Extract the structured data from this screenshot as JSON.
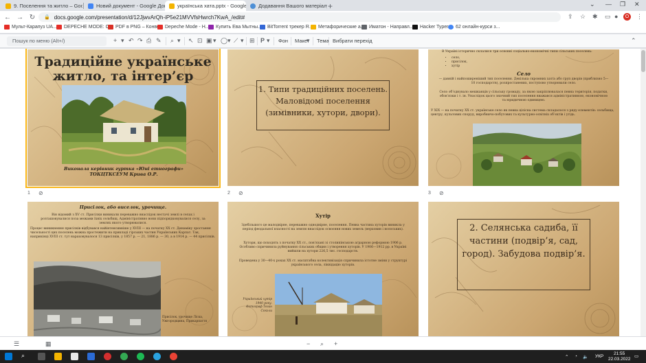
{
  "tabs": [
    {
      "label": "9. Поселення та житло – Google",
      "color": "#f4b400",
      "active": false
    },
    {
      "label": "Новий документ - Google Доку",
      "color": "#4285f4",
      "active": false
    },
    {
      "label": "українська хата.pptx - Google",
      "color": "#f4b400",
      "active": true
    },
    {
      "label": "Додавання Вашого матеріалу н",
      "color": "#4d8fd6",
      "active": false
    }
  ],
  "address": {
    "url": "docs.google.com/presentation/d/12JjwvArQh-iP5e21MVVfsHwrch7KwA_/edit#"
  },
  "bookmarks": [
    {
      "label": "Мульт-Карапуз UA...",
      "color": "#e52d27"
    },
    {
      "label": "DEPECHE MODE: C...",
      "color": "#e52d27"
    },
    {
      "label": "PDF в PNG – Конве...",
      "color": "#d93025"
    },
    {
      "label": "Depeche Mode - H...",
      "color": "#e52d27"
    },
    {
      "label": "Купить Ева Мытны...",
      "color": "#8e24aa"
    },
    {
      "label": "BitTorrent трекер R...",
      "color": "#3367d6"
    },
    {
      "label": "Метафорические а...",
      "color": "#f4b400"
    },
    {
      "label": "Иматон - Направл...",
      "color": "#5f6368"
    },
    {
      "label": "Hacker Typer",
      "color": "#111111"
    },
    {
      "label": "62 онлайн-курси з...",
      "color": "#4285f4"
    }
  ],
  "toolbar": {
    "menu_search_placeholder": "Пошук по меню (Alt+/)",
    "background": "Фон",
    "layout": "Макет",
    "theme": "Тема",
    "transition": "Вибрати перехід"
  },
  "slides": [
    {
      "num": "1",
      "title": "Традиційне українське житло, та інтер’єр",
      "caption": "Виконала керівник гуртка «Юні етнографи» ТОКЦТКСЕУМ Крива О.Р."
    },
    {
      "num": "2",
      "title": "1. Типи традиційних поселень. Маловідомі поселення (зимівники, хутори, двори)."
    },
    {
      "num": "3",
      "intro": "В Україні історично склалися три основні соціально-економічні типи сільських поселень:",
      "bullets": [
        "село,",
        "присілок,",
        "хутір"
      ],
      "heading": "Село",
      "p1": "— давній і найпоширеніший тип поселення. Декілька скромних хат/а або груп дворів (приблизно 5—10 господарств), розпростанених, поступово утворювали село.",
      "p2": "Село об’єднувало мешканців у сільську громаду, за якою закріплювалася певна територія, податки, обов’язки і т. ін. Унаслідок цього значний тип поселення вважався адміністративною, економічною та юридичною одиницею.",
      "p3": "У XIX — на початку XX ст. українське село як певна цілісна система складалося з ряду елементів: сельбища, центру, культових споруд, виробничо-побутових та культурно-освітніх об’єктів і угідь."
    },
    {
      "heading": "Присілок, або виселок, урочище.",
      "p1": "Він відомий з XV ст. Присілки виникали переважно внаслідок нестачі землі в селах і розташовувалися поза межами їхніх сельбищ. Адміністративно вони підпорядковувалися селу, за землях якого утворювалися.",
      "p2": "Процес виникнення присілків відбувався найінтенсивніше у XVIII — на початку XX ст. Динаміку зростання чисельності цих поселень можна простежити на прикладі гірських частин Українських Карпат. Так, наприкінці XVIII ст. тут нараховувалося 13 присілків, у 1857 р. — 21, 1886 р. — 30, а в 1914 р. — 44 присілків.",
      "photo_caption": "Присілок, урочище Ліска, Ужгородщина, Прикарпаття"
    },
    {
      "heading": "Хутір",
      "p1": "Здебільшого це малодвірне, переважно однодвірне, поселення. Певна частина хуторів виникла у період феодальної власності на землю внаслідок освоєння нових земель (верховин і волоських).",
      "p2": "Хутори, що походять з початку XX ст., пов’язані зі столипінською аграрною реформою 1906 р. Особливо спричинила руйнування сільських общин і утворення хуторів. У 1906—1912 рр. в Україні вийшли на хутори 226,5 тис. господарств.",
      "p3": "Проведена у 30—40-х роках XX ст. масштабна колективізація спричинила істотне зміни у структурі українського села, ліквідацію хуторів.",
      "photo_caption": "Український хутір 1940 року. Фотограф Теган Соколи"
    },
    {
      "title": "2. Селянська садиба, її частини (подвір’я, сад, город). Забудова подвір’я."
    }
  ],
  "taskbar": {
    "time": "21:55",
    "date": "22.03.2022",
    "lang": "УКР"
  }
}
